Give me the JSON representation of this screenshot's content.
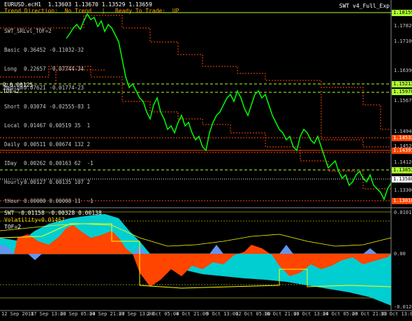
{
  "header": {
    "symbol_line": "EURUSD.ecH1  1.13603 1.13670 1.13529 1.13659",
    "status_line": "Trend Direction:  No Trend   |   Ready To Trade:  UP",
    "ea_name": "SWT v4_Full_Exp"
  },
  "stats": {
    "title": "SWT_SRLvl_TOF=2",
    "rows": [
      {
        "name": "Basic",
        "v1": "0.36452",
        "v2": "-0.11032",
        "v3": "-32"
      },
      {
        "name": "Long",
        "v1": "0.22657",
        "v2": "-0.07744",
        "v3": "-34"
      },
      {
        "name": "Medium",
        "v1": "0.07621",
        "v2": "-0.01774",
        "v3": "-23"
      },
      {
        "name": "Short",
        "v1": "0.03074",
        "v2": "-0.02555",
        "v3": "-83",
        "v4": "1"
      },
      {
        "name": "Local",
        "v1": "0.01467",
        "v2": "0.00519",
        "v3": "35",
        "v4": "1"
      },
      {
        "name": "Daily",
        "v1": "0.00511",
        "v2": "0.00674",
        "v3": "132",
        "v4": "2"
      },
      {
        "name": "IDay",
        "v1": "0.00262",
        "v2": "0.00163",
        "v3": "62",
        "v4": "-1"
      },
      {
        "name": "Hourly",
        "v1": "0.00127",
        "v2": "0.00135",
        "v3": "107",
        "v4": "2"
      },
      {
        "name": "tHour",
        "v1": "0.00080",
        "v2": "0.00008",
        "v3": "11",
        "v4": "-1"
      }
    ],
    "extra1": "R:0.00125",
    "extra2": "TOF=2"
  },
  "price_axis": {
    "labels": [
      "1.17820",
      "1.17100",
      "1.16390",
      "1.15670",
      "1.14940",
      "1.14520",
      "1.14120",
      "1.13300"
    ],
    "boxes": [
      {
        "price": "1.18159",
        "color": "#adff2f",
        "text": "#000"
      },
      {
        "price": "1.15213",
        "color": "#adff2f",
        "text": "#000"
      },
      {
        "price": "1.15978",
        "color": "#adff2f",
        "text": "#000"
      },
      {
        "price": "1.14533",
        "color": "#ff4500",
        "text": "#fff"
      },
      {
        "price": "1.14397",
        "color": "#ff4500",
        "text": "#fff"
      },
      {
        "price": "1.13853",
        "color": "#adff2f",
        "text": "#000"
      },
      {
        "price": "1.13588",
        "color": "#ffffff",
        "text": "#000"
      },
      {
        "price": "1.13010",
        "color": "#ff4500",
        "text": "#fff"
      }
    ]
  },
  "indicator": {
    "label": "SWT -0.01158 -0.00328 0.00138",
    "volatility": "Volatility=0.01467",
    "tof": "TOF=2",
    "axis": [
      "0.01011",
      "0.00",
      "-0.01264"
    ]
  },
  "date_axis": [
    "12 Sep 2018",
    "17 Sep 13:00",
    "20 Sep 05:00",
    "24 Sep 21:00",
    "27 Sep 13:00",
    "2 Oct 05:00",
    "4 Oct 21:00",
    "9 Oct 13:00",
    "12 Oct 05:00",
    "16 Oct 21:00",
    "19 Oct 13:00",
    "24 Oct 05:00",
    "26 Oct 21:00",
    "31 Oct 13:00"
  ],
  "colors": {
    "candles": "#00ff00",
    "orange": "#ff4500",
    "cyan": "#00ced1",
    "yellow": "#ffff00",
    "blue": "#6495ed"
  }
}
